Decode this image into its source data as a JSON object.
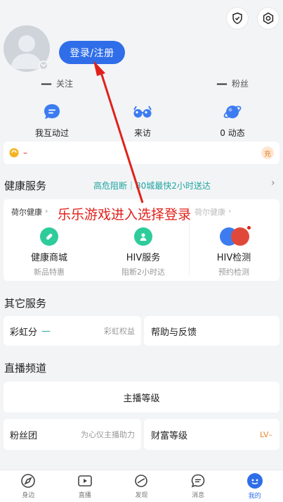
{
  "header": {
    "login_button": "登录/注册",
    "shield_icon": "shield-check-icon",
    "settings_icon": "gear-icon"
  },
  "stats": {
    "following_value": "—",
    "following_label": "关注",
    "fans_value": "—",
    "fans_label": "粉丝"
  },
  "quick_links": [
    {
      "label": "我互动过",
      "icon": "chat-bubble-icon",
      "color": "#3d7cf0"
    },
    {
      "label": "来访",
      "icon": "glasses-icon",
      "color": "#3d7cf0"
    },
    {
      "label": "0 动态",
      "icon": "planet-icon",
      "color": "#3d7cf0"
    }
  ],
  "coin_bar": {
    "value": "–",
    "recharge": "充"
  },
  "health": {
    "title": "健康服务",
    "promo": "高危阻断｜80城最快2小时送达",
    "promo_arrow": "›",
    "card_title": "荷尔健康",
    "card_title_arrow": "›",
    "card_title_right": "荷尔健康",
    "card_title_right_arrow": "›",
    "services": [
      {
        "name": "健康商城",
        "sub": "新品特惠",
        "color": "#2ecc9a",
        "icon": "pill-icon"
      },
      {
        "name": "HIV服务",
        "sub": "阻断2小时达",
        "color": "#2ecc9a",
        "icon": "doctor-icon"
      },
      {
        "name": "HIV检测",
        "sub": "预约检测",
        "color": "#3d7cf0",
        "icon": "shield-ribbon-icon"
      }
    ]
  },
  "overlay": {
    "annotation": "乐乐游戏进入选择登录",
    "color": "#e0211b"
  },
  "other": {
    "title": "其它服务",
    "rainbow_label": "彩虹分",
    "rainbow_value": "—",
    "rainbow_right": "彩虹权益",
    "help_label": "帮助与反馈"
  },
  "live": {
    "title": "直播频道",
    "anchor_level": "主播等级",
    "fan_group": "粉丝团",
    "fan_group_right": "为心仪主播助力",
    "wealth_level": "财富等级",
    "wealth_value": "LV–"
  },
  "tabs": [
    {
      "label": "身边",
      "icon": "compass-icon"
    },
    {
      "label": "直播",
      "icon": "video-icon"
    },
    {
      "label": "发现",
      "icon": "planet-icon"
    },
    {
      "label": "消息",
      "icon": "message-icon"
    },
    {
      "label": "我的",
      "icon": "profile-icon",
      "active": true
    }
  ]
}
